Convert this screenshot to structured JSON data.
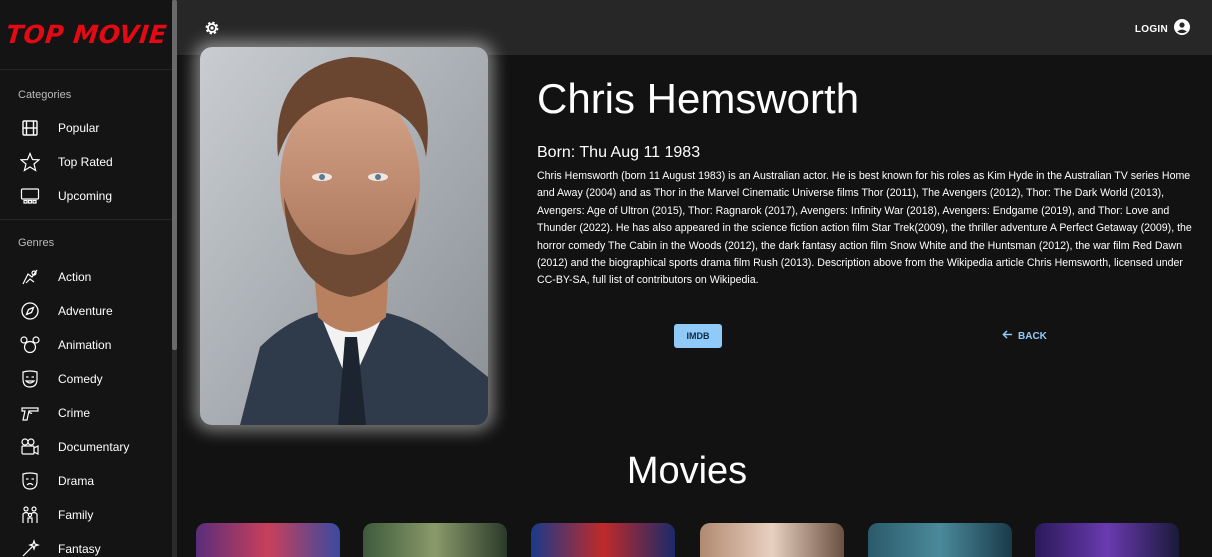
{
  "app": {
    "logo": "TOP MOVIE"
  },
  "sidebar": {
    "categories_title": "Categories",
    "categories": [
      {
        "label": "Popular",
        "icon": "film-icon"
      },
      {
        "label": "Top Rated",
        "icon": "star-icon"
      },
      {
        "label": "Upcoming",
        "icon": "cinema-screen-icon"
      }
    ],
    "genres_title": "Genres",
    "genres": [
      {
        "label": "Action",
        "icon": "action-icon"
      },
      {
        "label": "Adventure",
        "icon": "compass-icon"
      },
      {
        "label": "Animation",
        "icon": "mouse-ears-icon"
      },
      {
        "label": "Comedy",
        "icon": "laughing-mask-icon"
      },
      {
        "label": "Crime",
        "icon": "pistol-icon"
      },
      {
        "label": "Documentary",
        "icon": "camera-icon"
      },
      {
        "label": "Drama",
        "icon": "drama-mask-icon"
      },
      {
        "label": "Family",
        "icon": "family-icon"
      },
      {
        "label": "Fantasy",
        "icon": "magic-wand-icon"
      }
    ]
  },
  "topbar": {
    "login_label": "LOGIN"
  },
  "person": {
    "name": "Chris Hemsworth",
    "born": "Born: Thu Aug 11 1983",
    "bio": "Chris Hemsworth (born 11 August 1983) is an Australian actor. He is best known for his roles as Kim Hyde in the Australian TV series Home and Away (2004) and as Thor in the Marvel Cinematic Universe films Thor (2011), The Avengers (2012), Thor: The Dark World (2013), Avengers: Age of Ultron (2015), Thor: Ragnarok (2017), Avengers: Infinity War (2018), Avengers: Endgame (2019), and Thor: Love and Thunder (2022). He has also appeared in the science fiction action film Star Trek(2009), the thriller adventure A Perfect Getaway (2009), the horror comedy The Cabin in the Woods (2012), the dark fantasy action film Snow White and the Huntsman (2012), the war film Red Dawn (2012) and the biographical sports drama film Rush (2013). Description above from the Wikipedia article Chris Hemsworth, licensed under CC-BY-SA, full list of contributors on Wikipedia."
  },
  "actions": {
    "imdb_label": "IMDB",
    "back_label": "BACK"
  },
  "movies": {
    "heading": "Movies"
  },
  "colors": {
    "accent": "#90caf9",
    "logo": "#e50914",
    "topbar": "#272727",
    "background": "#121212"
  }
}
